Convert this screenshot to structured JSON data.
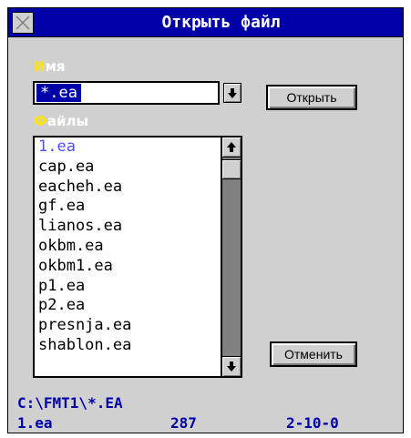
{
  "window": {
    "title": "Открыть файл",
    "close_icon": "close-icon"
  },
  "name_label": {
    "hot": "И",
    "rest": "мя"
  },
  "name_input": {
    "value": "*.ea"
  },
  "files_label": {
    "hot": "Ф",
    "rest": "айлы"
  },
  "files": [
    "1.ea",
    "cap.ea",
    "eacheh.ea",
    "gf.ea",
    "lianos.ea",
    "okbm.ea",
    "okbm1.ea",
    "p1.ea",
    "p2.ea",
    "presnja.ea",
    "shablon.ea"
  ],
  "selected_file": "1.ea",
  "scroll_position": 0.0,
  "buttons": {
    "open": "Открыть",
    "cancel": "Отменить"
  },
  "status": {
    "path": "C:\\FMT1\\*.EA",
    "file": "1.ea",
    "size": "287",
    "date": "2-10-0"
  },
  "colors": {
    "titlebar": "#0000a8",
    "dialog_bg": "#d0d0d0",
    "hotkey": "#ffe600",
    "selection": "#0000a8",
    "status_text": "#0000a8",
    "current_item": "#5050ff"
  },
  "icons": {
    "dropdown": "arrow-down-icon",
    "scroll_up": "arrow-up-icon",
    "scroll_down": "arrow-down-icon"
  }
}
